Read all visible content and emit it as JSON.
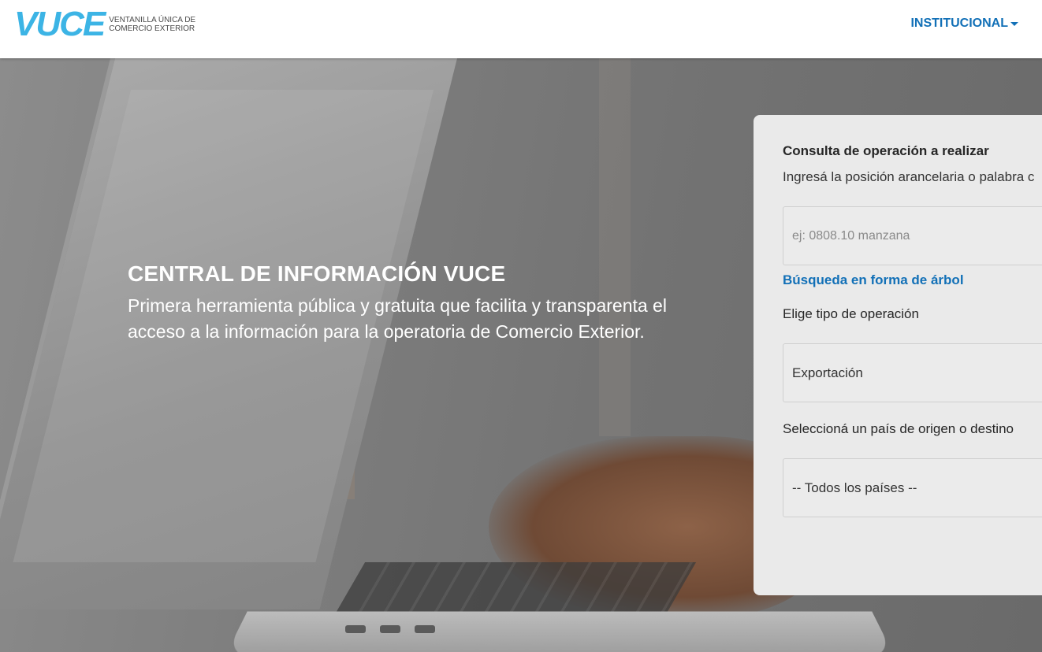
{
  "header": {
    "logo_word": "VUCE",
    "logo_sub_line1": "VENTANILLA ÚNICA DE",
    "logo_sub_line2": "COMERCIO EXTERIOR",
    "nav_institucional": "INSTITUCIONAL",
    "brand_color": "#3cb4e5",
    "link_color": "#1270b7"
  },
  "hero": {
    "title": "CENTRAL DE INFORMACIÓN VUCE",
    "desc_line1": "Primera herramienta pública y gratuita que facilita y transparenta el",
    "desc_line2": "acceso a la información para la operatoria de Comercio Exterior."
  },
  "search_card": {
    "title": "Consulta de operación a realizar",
    "hint": "Ingresá la posición arancelaria o palabra c",
    "input_placeholder": "ej: 0808.10 manzana",
    "input_value": "",
    "tree_link": "Búsqueda en forma de árbol",
    "operation_label": "Elige tipo de operación",
    "operation_value": "Exportación",
    "country_label": "Seleccioná un país de origen o destino",
    "country_value": "-- Todos los países --"
  }
}
